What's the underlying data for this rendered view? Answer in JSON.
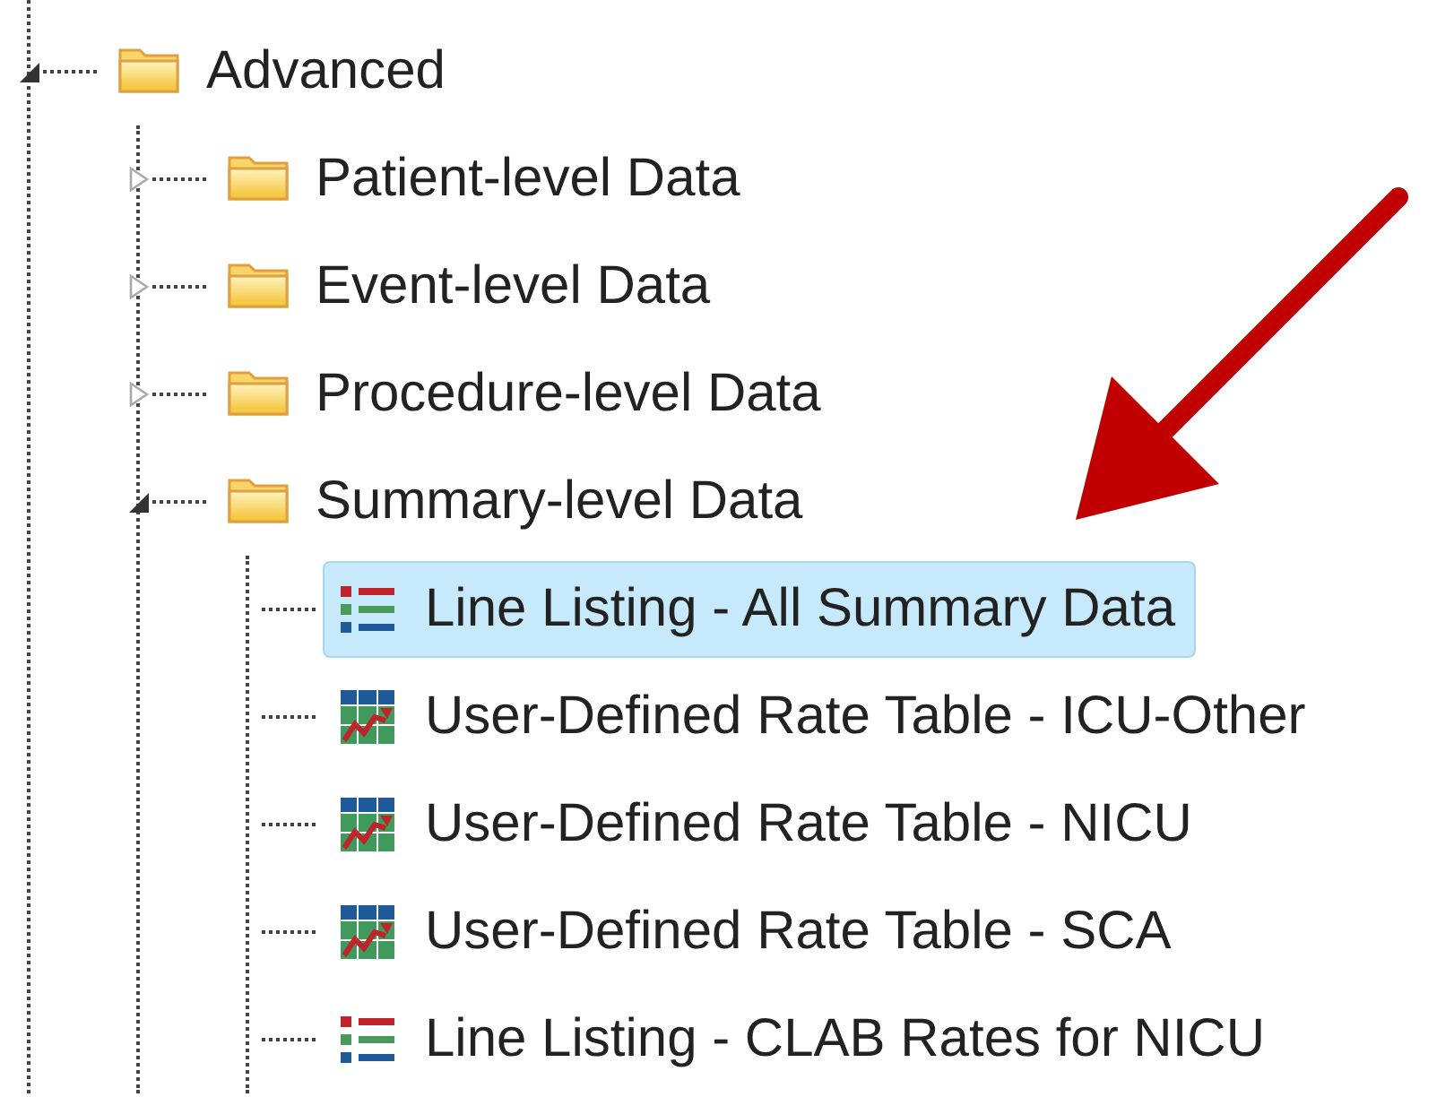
{
  "tree": [
    {
      "label": "Advanced",
      "kind": "folder",
      "expanded": true,
      "selected": false,
      "children": [
        {
          "label": "Patient-level Data",
          "kind": "folder",
          "expanded": false,
          "selected": false
        },
        {
          "label": "Event-level Data",
          "kind": "folder",
          "expanded": false,
          "selected": false
        },
        {
          "label": "Procedure-level Data",
          "kind": "folder",
          "expanded": false,
          "selected": false
        },
        {
          "label": "Summary-level Data",
          "kind": "folder",
          "expanded": true,
          "selected": false,
          "children": [
            {
              "label": "Line Listing - All Summary Data",
              "kind": "listing",
              "selected": true
            },
            {
              "label": "User-Defined Rate Table - ICU-Other",
              "kind": "rate-table",
              "selected": false
            },
            {
              "label": "User-Defined Rate Table - NICU",
              "kind": "rate-table",
              "selected": false
            },
            {
              "label": "User-Defined Rate Table - SCA",
              "kind": "rate-table",
              "selected": false
            },
            {
              "label": "Line Listing - CLAB Rates for NICU",
              "kind": "listing",
              "selected": false
            }
          ]
        }
      ]
    }
  ]
}
